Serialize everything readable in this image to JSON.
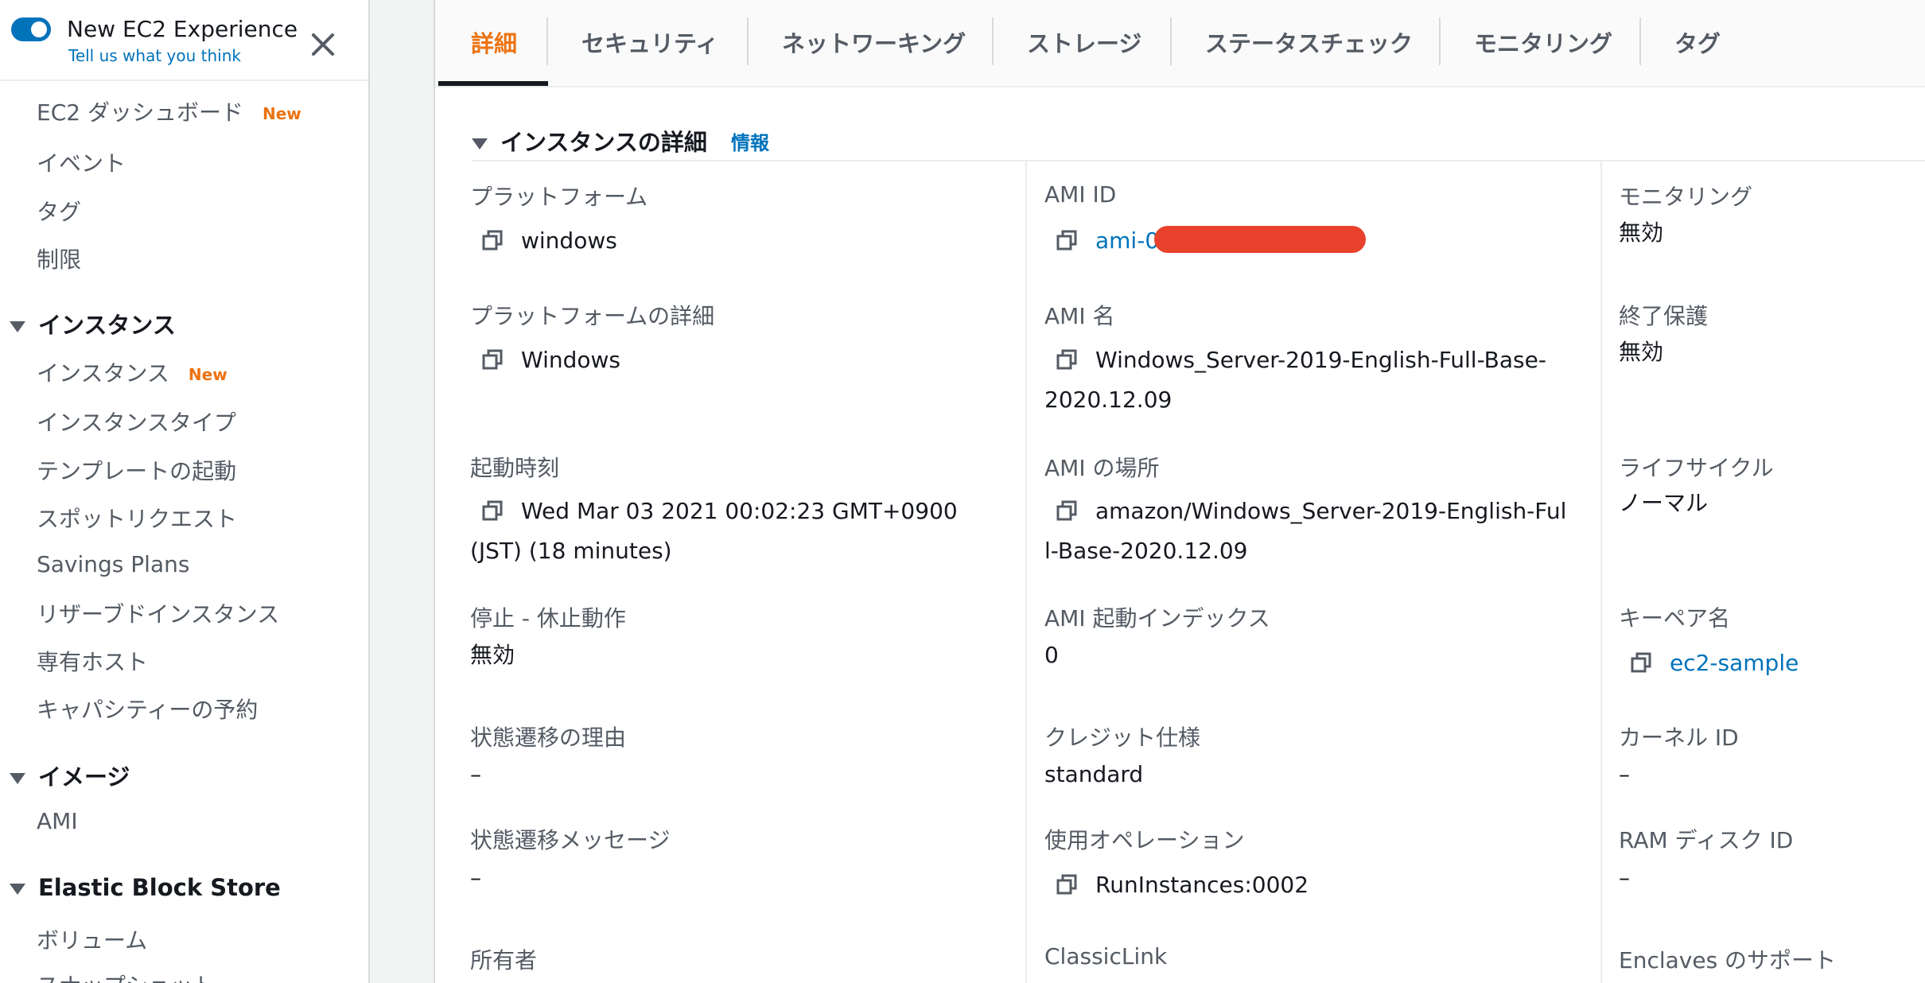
{
  "experience": {
    "title": "New EC2 Experience",
    "link": "Tell us what you think"
  },
  "sidebar": {
    "dashboard": "EC2 ダッシュボード",
    "dashboard_badge": "New",
    "events": "イベント",
    "tags": "タグ",
    "limits": "制限",
    "instances_section": "インスタンス",
    "instances": "インスタンス",
    "instances_badge": "New",
    "instance_types": "インスタンスタイプ",
    "launch_templates": "テンプレートの起動",
    "spot_requests": "スポットリクエスト",
    "savings_plans": "Savings Plans",
    "reserved_instances": "リザーブドインスタンス",
    "dedicated_hosts": "専有ホスト",
    "capacity_reservations": "キャパシティーの予約",
    "images_section": "イメージ",
    "ami": "AMI",
    "ebs_section": "Elastic Block Store",
    "volumes": "ボリューム",
    "snapshots": "スナップショット"
  },
  "tabs": [
    "詳細",
    "セキュリティ",
    "ネットワーキング",
    "ストレージ",
    "ステータスチェック",
    "モニタリング",
    "タグ"
  ],
  "details": {
    "section_title": "インスタンスの詳細",
    "info_link": "情報",
    "platform_label": "プラットフォーム",
    "platform_value": "windows",
    "platform_details_label": "プラットフォームの詳細",
    "platform_details_value": "Windows",
    "launch_time_label": "起動時刻",
    "launch_time_value": "Wed Mar 03 2021 00:02:23 GMT+0900 (JST) (18 minutes)",
    "stop_hibernate_label": "停止 - 休止動作",
    "stop_hibernate_value": "無効",
    "state_reason_label": "状態遷移の理由",
    "state_reason_value": "–",
    "state_message_label": "状態遷移メッセージ",
    "state_message_value": "–",
    "owner_label": "所有者",
    "ami_id_label": "AMI ID",
    "ami_id_value": "ami-0",
    "ami_name_label": "AMI 名",
    "ami_name_value": "Windows_Server-2019-English-Full-Base-2020.12.09",
    "ami_location_label": "AMI の場所",
    "ami_location_value": "amazon/Windows_Server-2019-English-Full-Base-2020.12.09",
    "ami_launch_index_label": "AMI 起動インデックス",
    "ami_launch_index_value": "0",
    "credit_spec_label": "クレジット仕様",
    "credit_spec_value": "standard",
    "usage_operation_label": "使用オペレーション",
    "usage_operation_value": "RunInstances:0002",
    "classiclink_label": "ClassicLink",
    "monitoring_label": "モニタリング",
    "monitoring_value": "無効",
    "termination_protection_label": "終了保護",
    "termination_protection_value": "無効",
    "lifecycle_label": "ライフサイクル",
    "lifecycle_value": "ノーマル",
    "key_pair_label": "キーペア名",
    "key_pair_value": "ec2-sample",
    "kernel_id_label": "カーネル ID",
    "kernel_id_value": "–",
    "ram_disk_id_label": "RAM ディスク ID",
    "ram_disk_id_value": "–",
    "enclaves_label": "Enclaves のサポート"
  },
  "colors": {
    "accent": "#ec7211",
    "link": "#0073bb",
    "redaction": "#e8412c"
  }
}
